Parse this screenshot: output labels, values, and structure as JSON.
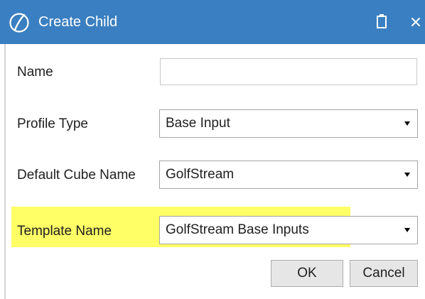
{
  "dialog": {
    "title": "Create Child",
    "logo_icon": "onestream-logo-icon",
    "titlebar_color": "#3a7fc1",
    "clipboard_icon": "clipboard-icon",
    "close_icon": "close-icon"
  },
  "form": {
    "name": {
      "label": "Name",
      "value": "",
      "placeholder": ""
    },
    "profile_type": {
      "label": "Profile Type",
      "value": "Base Input"
    },
    "default_cube_name": {
      "label": "Default Cube Name",
      "value": "GolfStream"
    },
    "template_name": {
      "label": "Template Name",
      "value": "GolfStream Base Inputs",
      "highlight_color": "#ffff66"
    }
  },
  "buttons": {
    "ok_label": "OK",
    "cancel_label": "Cancel"
  }
}
